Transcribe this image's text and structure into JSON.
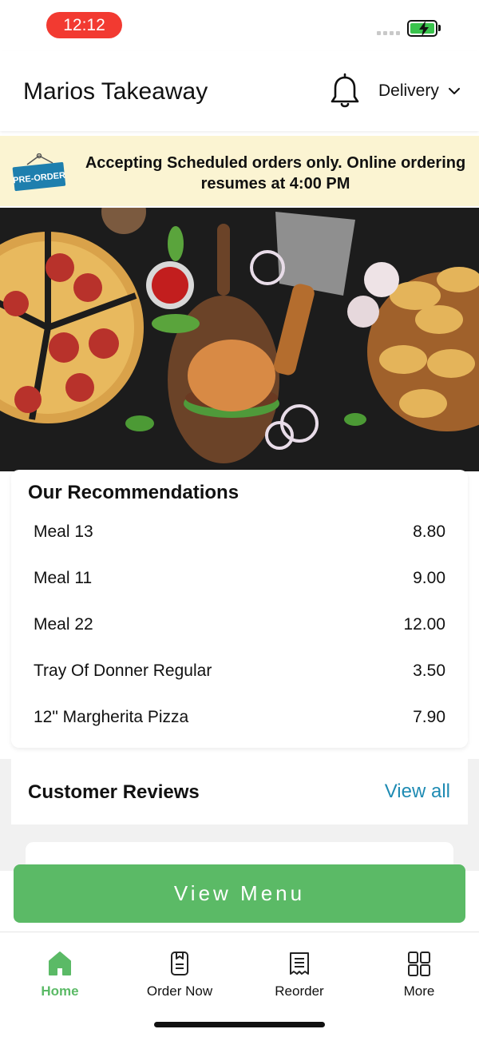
{
  "status_bar": {
    "time": "12:12"
  },
  "header": {
    "title": "Marios Takeaway",
    "mode": "Delivery"
  },
  "banner": {
    "tag": "PRE-ORDER",
    "message": "Accepting Scheduled orders only. Online ordering resumes at 4:00 PM"
  },
  "recommendations": {
    "title": "Our Recommendations",
    "items": [
      {
        "name": "Meal 13",
        "price": "8.80"
      },
      {
        "name": "Meal 11",
        "price": "9.00"
      },
      {
        "name": "Meal 22",
        "price": "12.00"
      },
      {
        "name": "Tray Of Donner Regular",
        "price": "3.50"
      },
      {
        "name": "12\" Margherita Pizza",
        "price": "7.90"
      }
    ]
  },
  "reviews": {
    "title": "Customer Reviews",
    "view_all": "View all"
  },
  "view_menu_label": "View Menu",
  "tabs": [
    {
      "label": "Home",
      "icon": "home-icon",
      "active": true
    },
    {
      "label": "Order Now",
      "icon": "order-icon",
      "active": false
    },
    {
      "label": "Reorder",
      "icon": "receipt-icon",
      "active": false
    },
    {
      "label": "More",
      "icon": "grid-icon",
      "active": false
    }
  ],
  "colors": {
    "accent_green": "#5bba66",
    "link_blue": "#1f8bb3",
    "banner_bg": "#fbf4d2",
    "time_pill": "#f23a31"
  }
}
